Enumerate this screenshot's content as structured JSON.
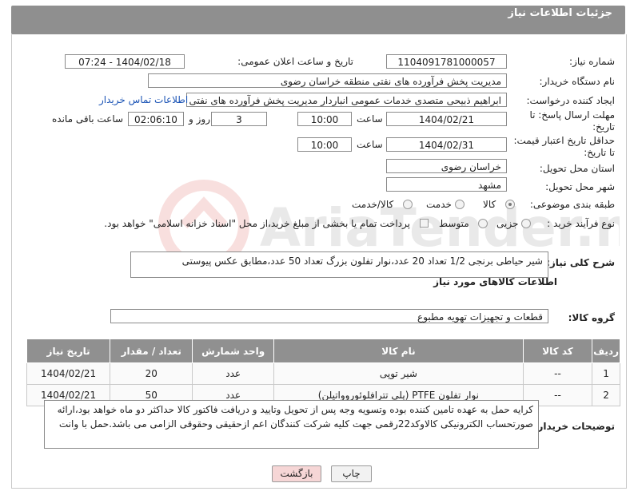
{
  "header": {
    "title": "جزئیات اطلاعات نیاز"
  },
  "fields": {
    "need_number_label": "شماره نیاز:",
    "need_number": "1104091781000057",
    "announce_label": "تاریخ و ساعت اعلان عمومی:",
    "announce_value": "1404/02/18 - 07:24",
    "buyer_org_label": "نام دستگاه خریدار:",
    "buyer_org": "مدیریت پخش فرآورده های نفتی منطقه خراسان رضوی",
    "creator_label": "ایجاد کننده درخواست:",
    "creator": "ابراهیم ذبیحی متصدی خدمات عمومی انباردار مدیریت پخش فرآورده های نفتی منطقه خراسان رضوی",
    "contact_link": "اطلاعات تماس خریدار",
    "deadline_label_1": "مهلت ارسال پاسخ: تا",
    "deadline_label_2": "تاریخ:",
    "deadline_date": "1404/02/21",
    "time_label": "ساعت",
    "deadline_time": "10:00",
    "days_value": "3",
    "days_label": "روز و",
    "remaining_value": "02:06:10",
    "remaining_label": "ساعت باقی مانده",
    "validity_label_1": "حداقل تاریخ اعتبار قیمت:",
    "validity_label_2": "تا تاریخ:",
    "validity_date": "1404/02/31",
    "validity_time": "10:00",
    "province_label": "استان محل تحویل:",
    "province": "خراسان رضوی",
    "city_label": "شهر محل تحویل:",
    "city": "مشهد",
    "category_label": "طبقه بندی موضوعی:",
    "category_options": [
      "کالا",
      "خدمت",
      "کالا/خدمت"
    ],
    "category_selected": "کالا",
    "process_label": "نوع فرآیند خرید :",
    "process_options": [
      "جزیی",
      "متوسط"
    ],
    "payment_note": "پرداخت تمام یا بخشی از مبلغ خرید،از محل \"اسناد خزانه اسلامی\" خواهد بود."
  },
  "summary": {
    "label": "شرح کلی نیاز:",
    "text": "شیر حیاطی برنجی 1/2 تعداد 20 عدد،نوار تفلون بزرگ تعداد 50 عدد،مطابق عکس پیوستی"
  },
  "goods": {
    "section_title": "اطلاعات کالاهای مورد نیاز",
    "group_label": "گروه کالا:",
    "group_value": "قطعات و تجهیزات تهویه مطبوع",
    "columns": [
      "ردیف",
      "کد کالا",
      "نام کالا",
      "واحد شمارش",
      "تعداد / مقدار",
      "تاریخ نیاز"
    ],
    "rows": [
      [
        "1",
        "--",
        "شیر توپی",
        "عدد",
        "20",
        "1404/02/21"
      ],
      [
        "2",
        "--",
        "نوار تفلون PTFE (پلی تترافلوئوروواتیلن)",
        "عدد",
        "50",
        "1404/02/21"
      ]
    ]
  },
  "buyer_notes": {
    "label": "توضیحات خریدار:",
    "text": "کرایه حمل به عهده تامین کننده بوده وتسویه وجه پس از تحویل وتایید و دریافت فاکتور کالا حداکثر دو ماه خواهد بود،ارائه صورتحساب الکترونیکی کالاوکد22رقمی جهت کلیه شرکت کنندگان اعم ازحقیقی وحقوقی الزامی می باشد.حمل با وانت"
  },
  "buttons": {
    "print": "چاپ",
    "back": "بازگشت"
  },
  "watermark": {
    "text": "AriaTender.net"
  },
  "colors": {
    "header_bg": "#8f8f8f",
    "link": "#1a53b5",
    "back_btn_bg": "#f6d6d6"
  }
}
